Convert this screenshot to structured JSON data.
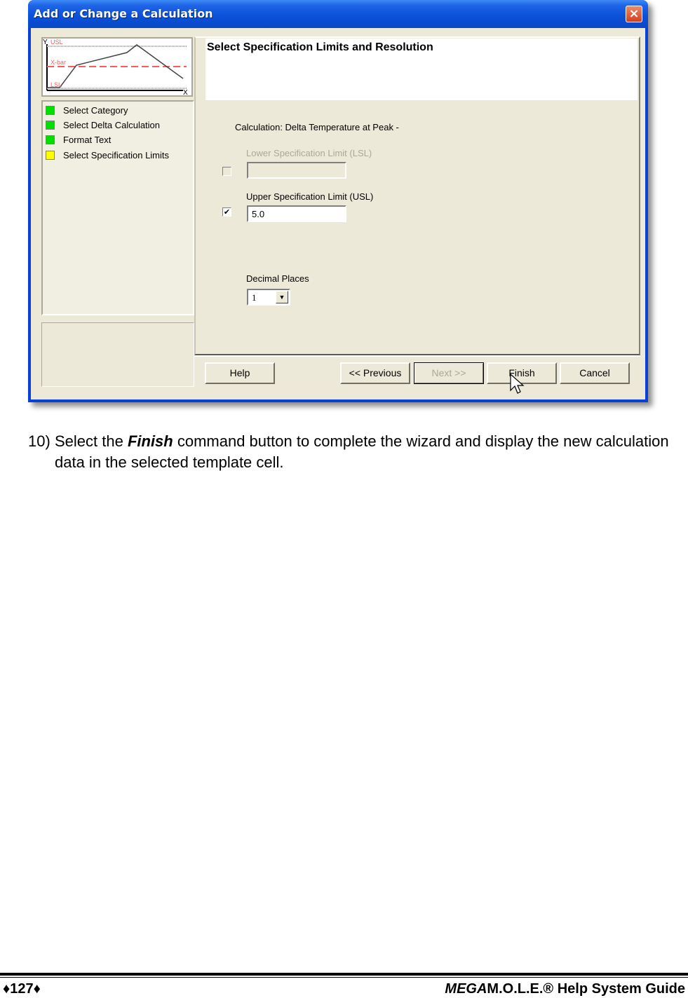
{
  "window": {
    "title": "Add or Change a Calculation",
    "close_icon": "×"
  },
  "chart_thumbnail": {
    "y_label": "Y",
    "x_label": "X",
    "usl_label": "USL",
    "xbar_label": "X-bar",
    "lsl_label": "LSL",
    "limit_color": "#ff5a5a"
  },
  "steps": [
    {
      "label": "Select Category",
      "status": "complete",
      "color": "#00e000"
    },
    {
      "label": "Select Delta Calculation",
      "status": "complete",
      "color": "#00e000"
    },
    {
      "label": "Format Text",
      "status": "complete",
      "color": "#00e000"
    },
    {
      "label": "Select Specification Limits",
      "status": "current",
      "color": "#ffff00"
    }
  ],
  "panel": {
    "title": "Select Specification Limits and Resolution",
    "calculation_label": "Calculation: Delta Temperature at Peak -",
    "lsl": {
      "label": "Lower Specification Limit (LSL)",
      "checked": false,
      "value": ""
    },
    "usl": {
      "label": "Upper Specification Limit (USL)",
      "checked": true,
      "value": "5.0"
    },
    "decimal": {
      "label": "Decimal Places",
      "value": "1"
    }
  },
  "buttons": {
    "help": "Help",
    "previous": "<< Previous",
    "next": "Next >>",
    "finish": "Finish",
    "cancel": "Cancel"
  },
  "instruction": {
    "number": "10)",
    "prefix": "Select the ",
    "emphasis": "Finish",
    "suffix": " command button to complete the wizard and display the new calculation data in the selected template cell."
  },
  "footer": {
    "page_number": "♦127♦",
    "guide_brand": "MEGA",
    "guide_rest": "M.O.L.E.® Help System Guide"
  }
}
